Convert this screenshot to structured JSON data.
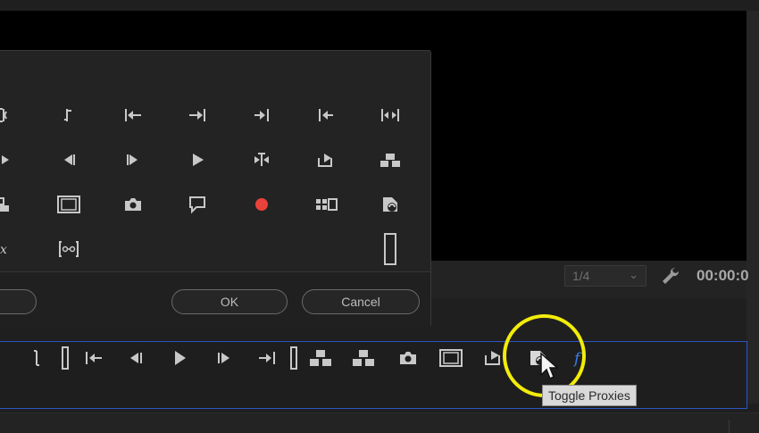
{
  "monitor": {
    "resolution_value": "1/4",
    "timecode": "00:00:0",
    "settings_icon": "wrench-icon"
  },
  "button_editor": {
    "ok_label": "OK",
    "cancel_label": "Cancel",
    "grid_icons": [
      "insert-icon",
      "mark-out-icon",
      "go-to-previous-edit-icon",
      "go-to-next-edit-icon",
      "go-to-out-icon",
      "go-to-in-icon",
      "play-in-to-out-icon",
      "step-back-partial-icon",
      "step-back-icon",
      "step-forward-icon",
      "play-icon",
      "trim-icon",
      "export-frame-icon",
      "lift-icon",
      "extract-icon",
      "safe-margins-icon",
      "camera-icon",
      "comment-marker-icon",
      "record-icon",
      "multi-camera-icon",
      "toggle-proxies-icon",
      "fx-icon",
      "loop-icon",
      "spacer-icon"
    ]
  },
  "transport": {
    "buttons": [
      "mark-out-icon",
      "mark-clip-icon",
      "go-to-in-icon",
      "step-back-icon",
      "play-icon",
      "step-forward-icon",
      "go-to-out-icon",
      "mark-clip-end-icon",
      "lift-icon",
      "extract-icon",
      "camera-icon",
      "safe-margins-icon",
      "export-frame-icon",
      "toggle-proxies-icon",
      "fx-icon"
    ]
  },
  "tooltip": {
    "text": "Toggle Proxies"
  },
  "colors": {
    "accent_blue": "#2c54c4",
    "highlight_yellow": "#f2ec0a",
    "record_red": "#e8423a",
    "fx_blue": "#3f7de8"
  }
}
